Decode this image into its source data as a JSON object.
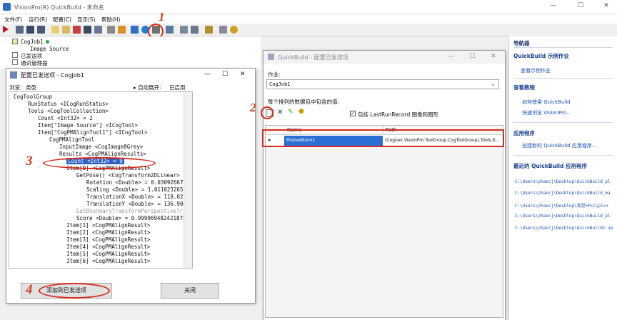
{
  "app": {
    "title": "VisionPro(R) QuickBuild - 未命名",
    "minimize_glyph": "—",
    "maximize_glyph": "☐",
    "close_glyph": "✕"
  },
  "menubar": {
    "items": [
      "文件(F)",
      "运行(R)",
      "配置(C)",
      "显示(S)",
      "帮助(H)"
    ]
  },
  "left_tree": {
    "job": "CogJob1",
    "image_source": "Image Source",
    "posted_items": "已发送项",
    "comm_manager": "通讯管理器"
  },
  "dlg_config": {
    "title": "配置已发送项 - CogJob1",
    "browse_label": "浏览:",
    "browse_value": "类型",
    "auto_expand_label": "▸ 自动展开:",
    "auto_expand_value": "已启用",
    "tree": [
      "CogToolGroup",
      "RunStatus <ICogRunStatus>",
      "Tools <CogToolCollection>",
      "Count <Int32> = 2",
      "Item[\"Image Source\"] <ICogTool>",
      "Item[\"CogPMAlignTool1\"] <ICogTool>",
      "CogPMAlignTool",
      "InputImage <CogImage8Grey>",
      "Results <CogPMAlignResults>",
      "Count <Int32> = 9",
      "Item[0] <CogPMAlignResult>",
      "GetPose() <CogTransform2DLinear>",
      "Rotation <Double> = 0.0309266714021",
      "Scaling <Double> = 1.0110232652513",
      "TranslationX <Double> = 110.026132",
      "TranslationY <Double> = 136.904367",
      "GetBoundaryTransformPerspectiveTr",
      "Score <Double> = 0.999969482421875",
      "Item[1] <CogPMAlignResult>",
      "Item[2] <CogPMAlignResult>",
      "Item[3] <CogPMAlignResult>",
      "Item[4] <CogPMAlignResult>",
      "Item[5] <CogPMAlignResult>",
      "Item[6] <CogPMAlignResult>"
    ],
    "add_button": "添加到已发送项",
    "close_button": "关闭"
  },
  "dlg_quickbuild": {
    "title": "QuickBuild - 配置已发送项",
    "job_label": "作业:",
    "job_value": "CogJob1",
    "list_label": "每个排列的数据包中包含的值:",
    "checkbox_label": "包括 LastRunRecord 图像和图形",
    "checkbox_checked": true,
    "col_name": "Name",
    "col_path": "Path",
    "row_name": "PostedItem1",
    "row_path": "(Cognex.VisionPro.ToolGroup.CogToolGroup).Tools.It..."
  },
  "right_panel": {
    "header": "导航器",
    "sample_head": "QuickBuild 示例作业",
    "sample_link": "查看示例作业",
    "tutorial_head": "查看教程",
    "tutorial_1": "如何使用 QuickBuild",
    "tutorial_2": "快速浏览 VisionPro...",
    "app_head": "应用程序",
    "app_link": "创建新的 QuickBuild 应用程序...",
    "recent_head": "最近的 QuickBuild 应用程序",
    "recent": [
      "C:\\Users\\zhaocj\\Desktop\\QuickBuild_pl",
      "C:\\Users\\zhaocj\\Desktop\\QuickBuild_ma",
      "C:\\Users\\zhaocj\\Desktop\\视觉+PLC\\plc+",
      "C:\\Users\\zhaocj\\Desktop\\QuickBuild_pl",
      "C:\\Users\\zhaocj\\Desktop\\QuickBuild1 vp"
    ]
  },
  "annotations": [
    "1",
    "2",
    "3",
    "4"
  ]
}
